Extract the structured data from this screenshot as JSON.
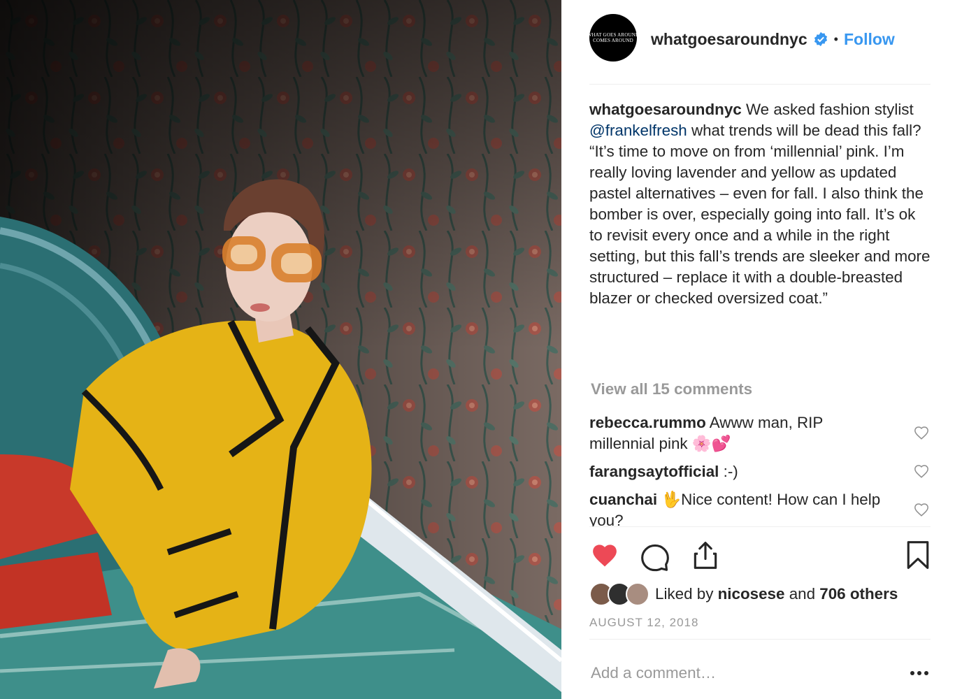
{
  "post": {
    "username": "whatgoesaroundnyc",
    "avatar_text_line1": "WHAT GOES AROUND",
    "avatar_text_line2": "COMES AROUND",
    "follow_label": "Follow",
    "separator": "•",
    "caption": {
      "username": "whatgoesaroundnyc",
      "text_before_mention": " We asked fashion stylist ",
      "mention": "@frankelfresh",
      "text_after_mention": " what trends will be dead this fall?\n“It’s time to move on from ‘millennial’ pink. I’m really loving lavender and yellow as updated pastel alternatives – even for fall. I also think the bomber is over, especially going into fall. It’s ok to revisit every once and a while in the right setting, but this fall’s trends are sleeker and more structured – replace it with a double-breasted blazer or checked oversized coat.”"
    },
    "view_all_comments": "View all 15 comments",
    "comments": [
      {
        "user": "rebecca.rummo",
        "text": " Awww man, RIP millennial pink 🌸💕"
      },
      {
        "user": "farangsaytofficial",
        "text": " :-)"
      },
      {
        "user": "cuanchai",
        "text": " 🖖Nice content! How can I help you?"
      }
    ],
    "likes": {
      "prefix": "Liked by ",
      "user": "nicosese",
      "middle": " and ",
      "others": "706 others"
    },
    "date": "AUGUST 12, 2018",
    "add_comment_placeholder": "Add a comment…"
  },
  "icons": {
    "verified": "verified-badge-icon",
    "like": "heart-filled-icon",
    "comment": "comment-bubble-icon",
    "share": "share-upload-icon",
    "save": "bookmark-icon",
    "comment_like": "heart-outline-icon",
    "more": "more-options-icon"
  },
  "colors": {
    "accent": "#3897f0",
    "like_red": "#ed4956",
    "mention": "#003569",
    "muted": "#999999"
  }
}
